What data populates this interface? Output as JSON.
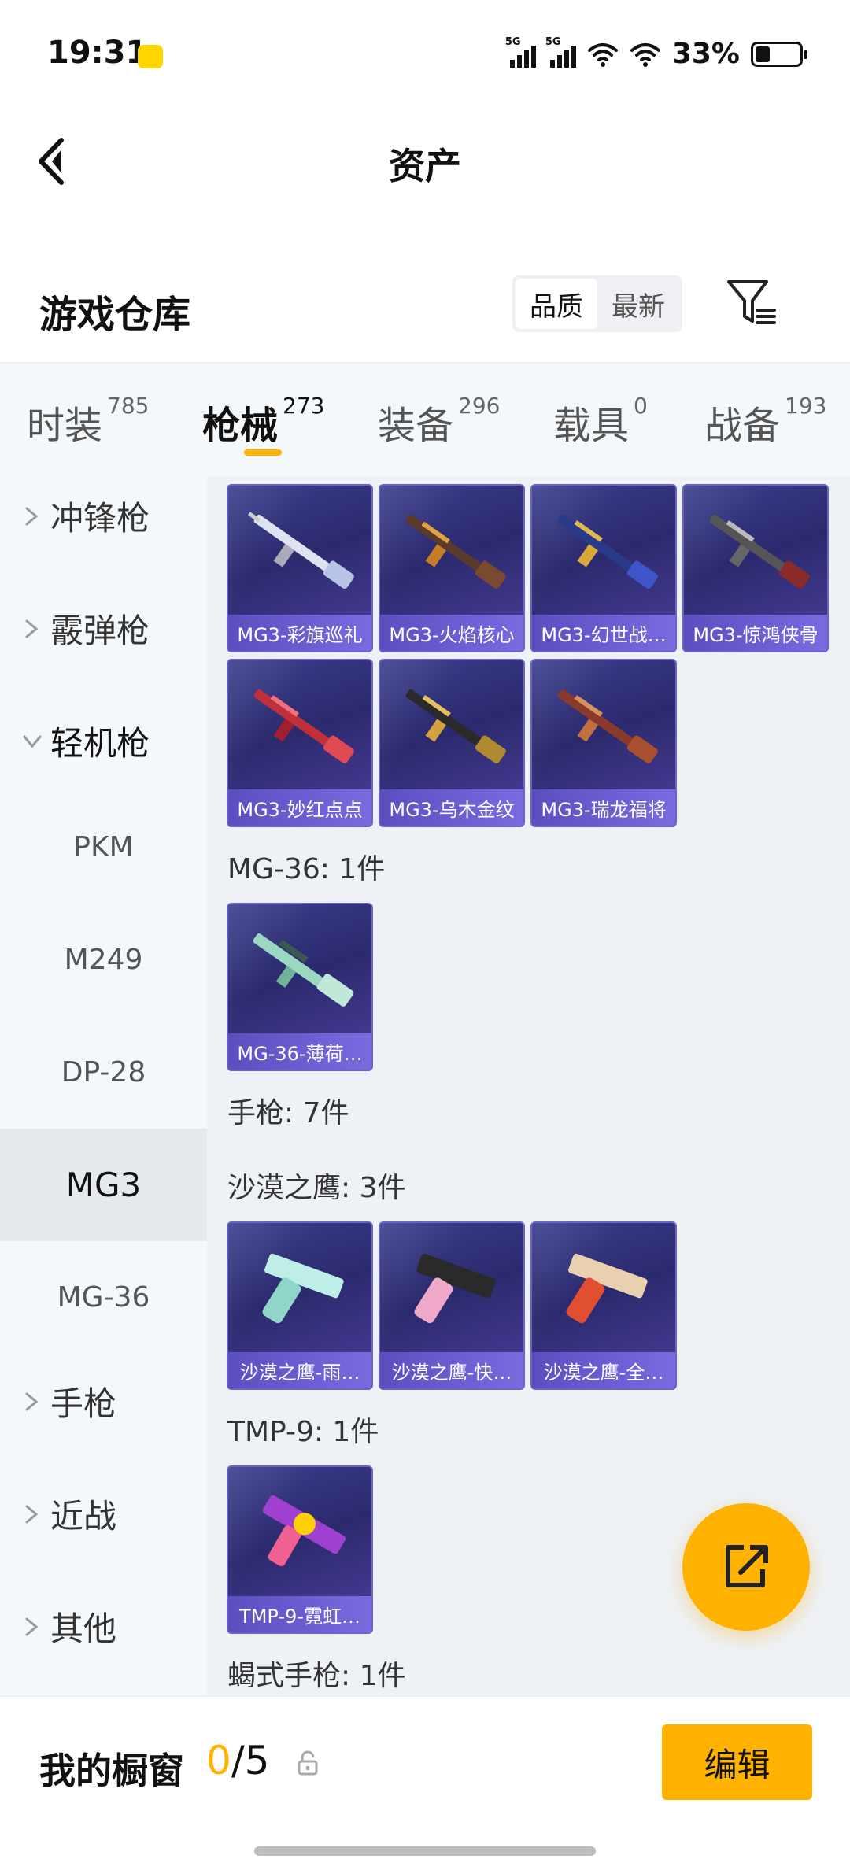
{
  "status_bar": {
    "time": "19:31",
    "network_tag_1": "5G",
    "network_tag_2": "5G",
    "battery_pct": "33%",
    "battery_level": 0.33
  },
  "header": {
    "title": "资产",
    "back_icon": "chevron-left-icon"
  },
  "warehouse": {
    "title": "游戏仓库",
    "sort_options": [
      "品质",
      "最新"
    ],
    "sort_selected": "品质",
    "filter_icon": "filter-icon"
  },
  "tabs": [
    {
      "label": "时装",
      "count": "785"
    },
    {
      "label": "枪械",
      "count": "273"
    },
    {
      "label": "装备",
      "count": "296"
    },
    {
      "label": "载具",
      "count": "0"
    },
    {
      "label": "战备",
      "count": "193"
    }
  ],
  "active_tab": "枪械",
  "sidebar": {
    "categories": [
      "冲锋枪",
      "霰弹枪",
      "轻机枪",
      "手枪",
      "近战",
      "其他"
    ],
    "expanded": "轻机枪",
    "subitems": [
      "PKM",
      "M249",
      "DP-28",
      "MG3",
      "MG-36"
    ],
    "selected_sub": "MG3"
  },
  "groups": [
    {
      "title": "",
      "items": [
        "MG3-彩旗巡礼",
        "MG3-火焰核心",
        "MG3-幻世战…",
        "MG3-惊鸿侠骨",
        "MG3-妙红点点",
        "MG3-乌木金纹",
        "MG3-瑞龙福将"
      ]
    },
    {
      "title": "MG-36: 1件",
      "items": [
        "MG-36-薄荷…"
      ]
    },
    {
      "title": "手枪: 7件",
      "items": []
    },
    {
      "title": "沙漠之鹰: 3件",
      "items": [
        "沙漠之鹰-雨…",
        "沙漠之鹰-快…",
        "沙漠之鹰-全…"
      ]
    },
    {
      "title": "TMP-9: 1件",
      "items": [
        "TMP-9-霓虹…"
      ]
    },
    {
      "title": "蝎式手枪: 1件",
      "items": []
    }
  ],
  "fab": {
    "icon": "share-icon"
  },
  "bottom": {
    "showcase_label": "我的橱窗",
    "showcase_current": "0",
    "showcase_total": "/5",
    "edit_label": "编辑"
  },
  "colors": {
    "accent": "#ffb300",
    "card_bg": "#2c2a6e",
    "caption_bg": "#6b5ed6"
  }
}
